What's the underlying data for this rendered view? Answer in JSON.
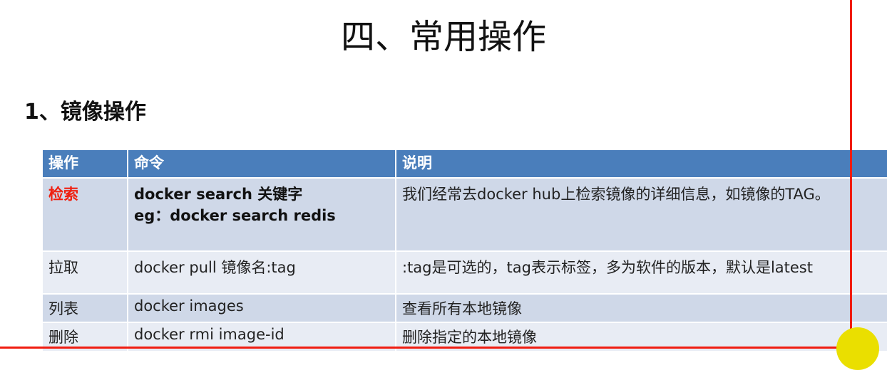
{
  "title": "四、常用操作",
  "subtitle": "1、镜像操作",
  "table": {
    "headers": [
      "操作",
      "命令",
      "说明"
    ],
    "rows": [
      {
        "op": "检索",
        "cmd": "docker search 关键字",
        "cmd2": "eg：docker search redis",
        "desc": "我们经常去docker hub上检索镜像的详细信息，如镜像的TAG。"
      },
      {
        "op": "拉取",
        "cmd": "docker pull 镜像名:tag",
        "desc": ":tag是可选的，tag表示标签，多为软件的版本，默认是latest"
      },
      {
        "op": "列表",
        "cmd": "docker images",
        "desc": "查看所有本地镜像"
      },
      {
        "op": "删除",
        "cmd": "docker rmi image-id",
        "desc": "删除指定的本地镜像"
      }
    ]
  },
  "colors": {
    "header": "#4a7ebb",
    "highlight": "#f02010",
    "annotation": "#f01c10",
    "cursor": "#eadf00"
  }
}
